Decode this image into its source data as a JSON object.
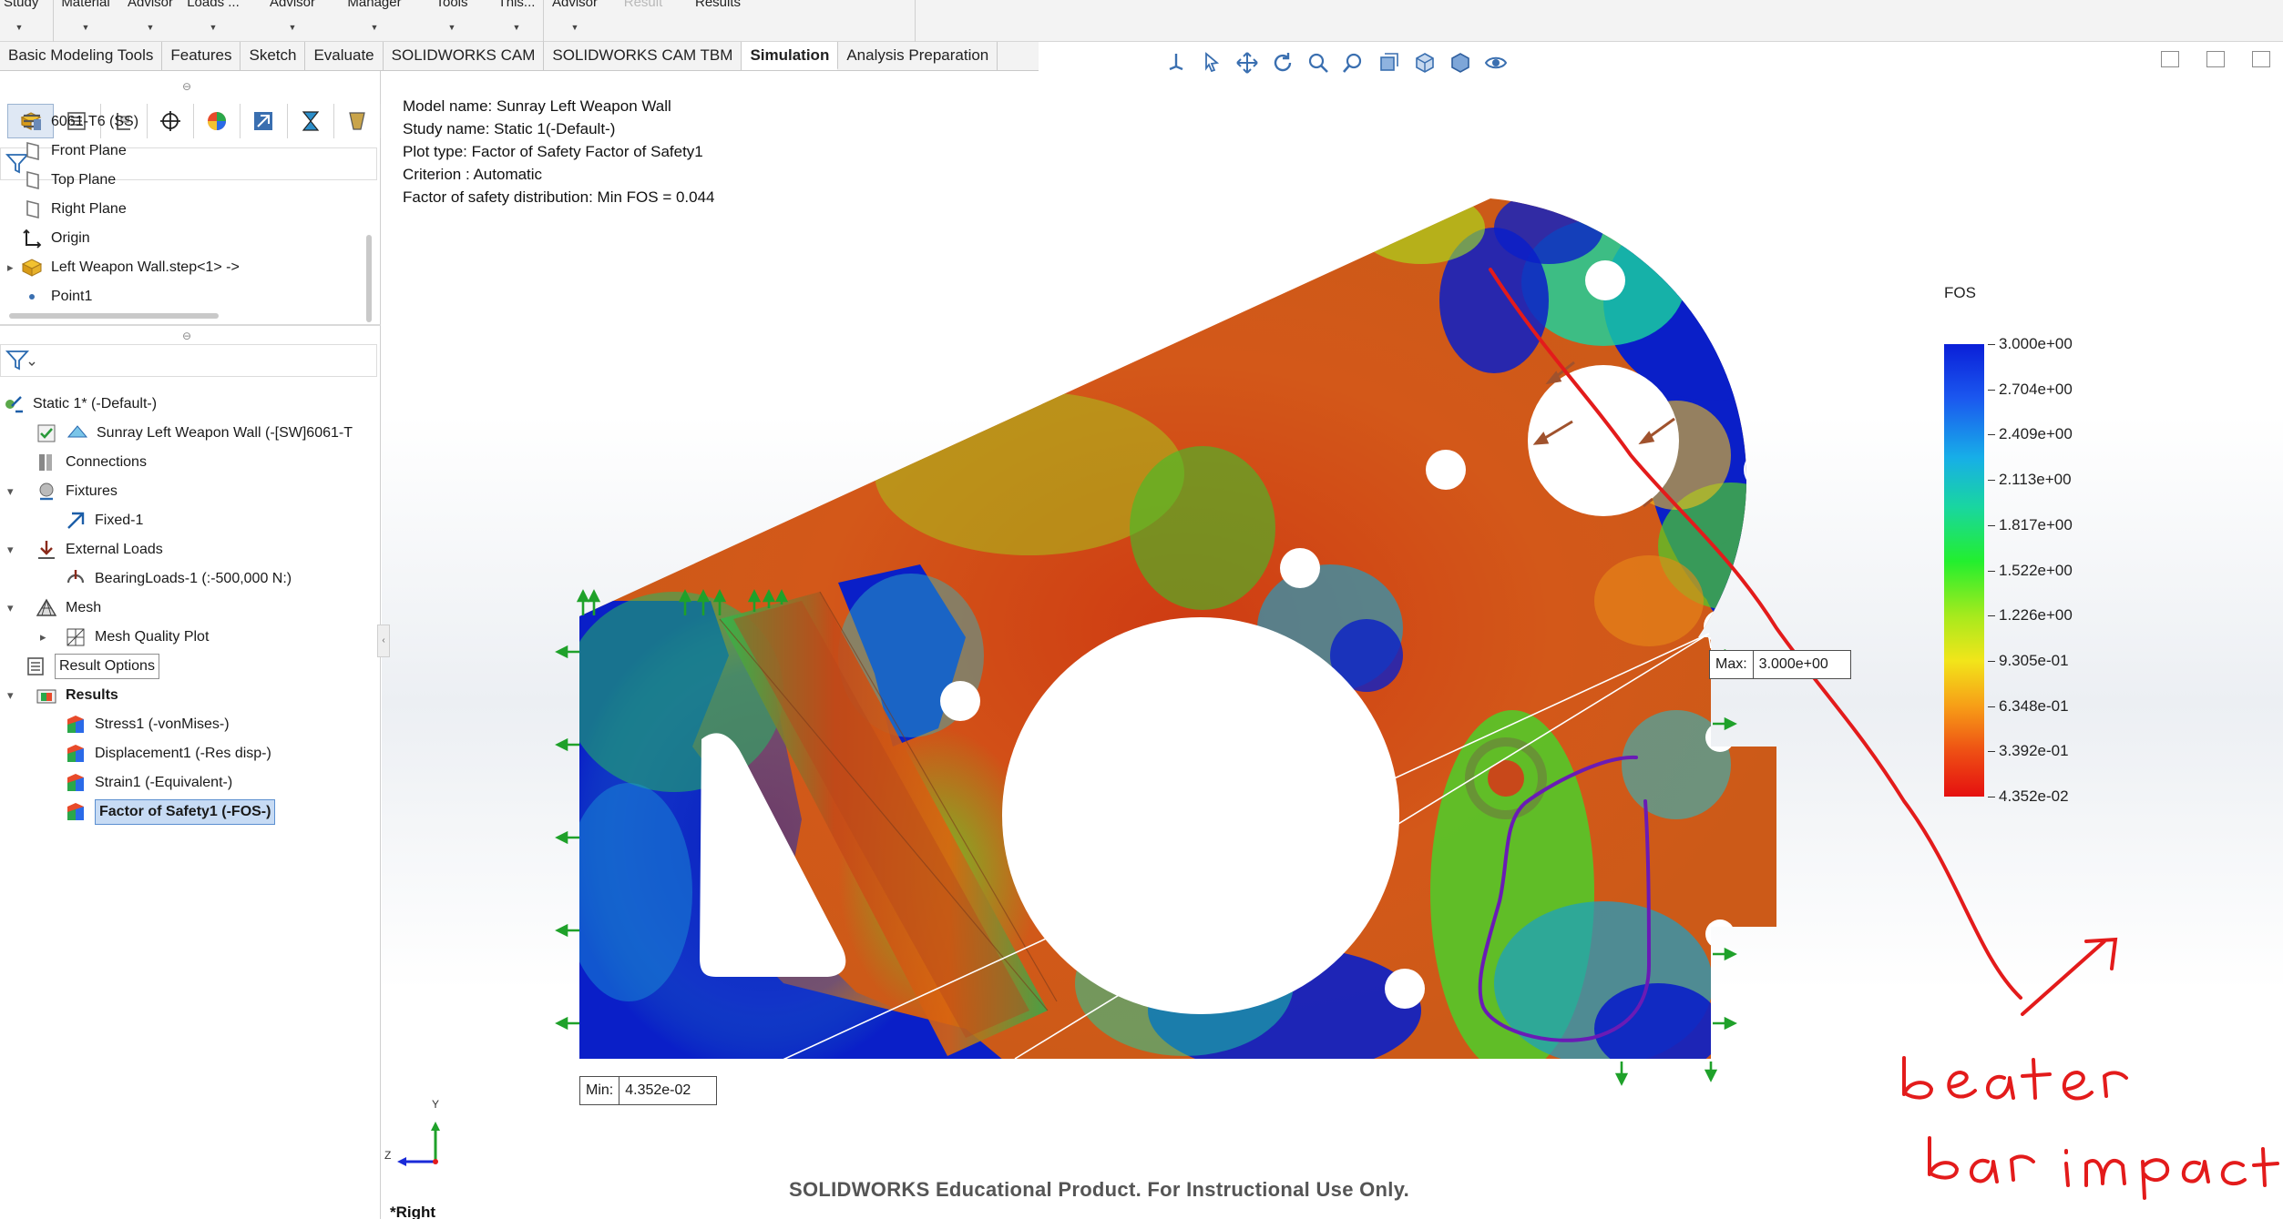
{
  "ribbon": {
    "buttons": [
      {
        "label": "Study"
      },
      {
        "label": "Material"
      },
      {
        "label": "Advisor"
      },
      {
        "label": "Loads ..."
      },
      {
        "label": "Advisor"
      },
      {
        "label": "Manager"
      },
      {
        "label": "Tools"
      },
      {
        "label": "This..."
      },
      {
        "label": "Advisor"
      },
      {
        "label": "Result"
      },
      {
        "label": "Results"
      }
    ]
  },
  "tabs": [
    {
      "label": "Basic Modeling Tools"
    },
    {
      "label": "Features"
    },
    {
      "label": "Sketch"
    },
    {
      "label": "Evaluate"
    },
    {
      "label": "SOLIDWORKS CAM"
    },
    {
      "label": "SOLIDWORKS CAM TBM"
    },
    {
      "label": "Simulation"
    },
    {
      "label": "Analysis Preparation"
    }
  ],
  "feature_tree": {
    "items": [
      {
        "label": "6061-T6 (SS)"
      },
      {
        "label": "Front Plane"
      },
      {
        "label": "Top Plane"
      },
      {
        "label": "Right Plane"
      },
      {
        "label": "Origin"
      },
      {
        "label": "Left Weapon Wall.step<1> ->"
      },
      {
        "label": "Point1"
      }
    ]
  },
  "study_tree": {
    "study": "Static 1* (-Default-)",
    "part": "Sunray Left Weapon Wall (-[SW]6061-T",
    "connections": "Connections",
    "fixtures": "Fixtures",
    "fixed": "Fixed-1",
    "external_loads": "External Loads",
    "bearing_loads": "BearingLoads-1 (:-500,000 N:)",
    "mesh": "Mesh",
    "mesh_quality": "Mesh Quality Plot",
    "result_options": "Result Options",
    "results": "Results",
    "stress": "Stress1 (-vonMises-)",
    "displacement": "Displacement1 (-Res disp-)",
    "strain": "Strain1 (-Equivalent-)",
    "fos": "Factor of Safety1 (-FOS-)"
  },
  "plot_info": {
    "model_name": "Model name: Sunray Left Weapon Wall",
    "study_name": "Study name: Static 1(-Default-)",
    "plot_type": "Plot type: Factor of Safety Factor of Safety1",
    "criterion": "Criterion : Automatic",
    "distribution": "Factor of safety distribution: Min FOS = 0.044"
  },
  "legend": {
    "title": "FOS",
    "labels": [
      "3.000e+00",
      "2.704e+00",
      "2.409e+00",
      "2.113e+00",
      "1.817e+00",
      "1.522e+00",
      "1.226e+00",
      "9.305e-01",
      "6.348e-01",
      "3.392e-01",
      "4.352e-02"
    ]
  },
  "probes": {
    "max_key": "Max:",
    "max_value": "3.000e+00",
    "min_key": "Min:",
    "min_value": "4.352e-02"
  },
  "annotation": {
    "line1": "beater",
    "line2": "bar impact"
  },
  "triad": {
    "y": "Y",
    "z": "Z"
  },
  "watermark": "SOLIDWORKS Educational Product. For Instructional Use Only.",
  "view_name": "*Right",
  "colors": {
    "fos_max": "#0a1fd8",
    "fos_min": "#e51010",
    "restraint_arrow": "#1fa12a",
    "load_arrow": "#a0522d",
    "annotation_red": "#e31b1b",
    "annotation_purple": "#6a1bb5",
    "active_tab_accent": "#ffffff"
  }
}
